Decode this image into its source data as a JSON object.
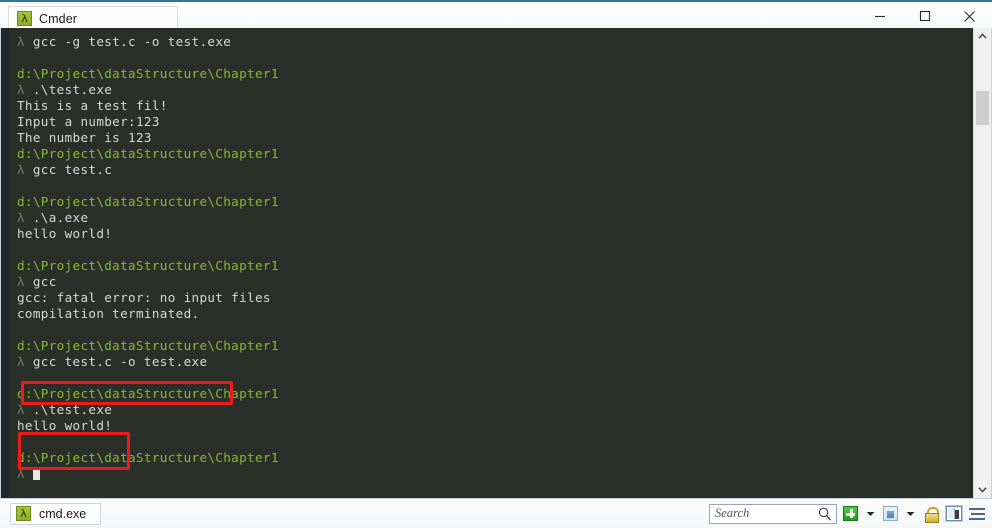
{
  "window": {
    "app_title": "Cmder",
    "tab_icon": "lambda-icon",
    "minimize_label": "Minimize",
    "maximize_label": "Maximize",
    "close_label": "Close"
  },
  "colors": {
    "path_green": "#8ab82e",
    "prompt_gray": "#6f7a63",
    "output_gray": "#d7d9d3",
    "terminal_bg": "#2b2f29",
    "annotation_red": "#ee1b1b",
    "titlebar_accent": "#2e7899"
  },
  "terminal": {
    "prompt_symbol": "λ",
    "cursor": "block-cursor",
    "lines": [
      {
        "type": "command",
        "prompt": "λ ",
        "text": "gcc -g test.c -o test.exe"
      },
      {
        "type": "blank",
        "text": ""
      },
      {
        "type": "path",
        "text": "d:\\Project\\dataStructure\\Chapter1"
      },
      {
        "type": "command",
        "prompt": "λ ",
        "text": ".\\test.exe"
      },
      {
        "type": "output",
        "text": "This is a test fil!"
      },
      {
        "type": "output",
        "text": "Input a number:123"
      },
      {
        "type": "output",
        "text": "The number is 123"
      },
      {
        "type": "path",
        "text": "d:\\Project\\dataStructure\\Chapter1"
      },
      {
        "type": "command",
        "prompt": "λ ",
        "text": "gcc test.c"
      },
      {
        "type": "blank",
        "text": ""
      },
      {
        "type": "path",
        "text": "d:\\Project\\dataStructure\\Chapter1"
      },
      {
        "type": "command",
        "prompt": "λ ",
        "text": ".\\a.exe"
      },
      {
        "type": "output",
        "text": "hello world!"
      },
      {
        "type": "blank",
        "text": ""
      },
      {
        "type": "path",
        "text": "d:\\Project\\dataStructure\\Chapter1"
      },
      {
        "type": "command",
        "prompt": "λ ",
        "text": "gcc"
      },
      {
        "type": "output",
        "text": "gcc: fatal error: no input files"
      },
      {
        "type": "output",
        "text": "compilation terminated."
      },
      {
        "type": "blank",
        "text": ""
      },
      {
        "type": "path",
        "text": "d:\\Project\\dataStructure\\Chapter1"
      },
      {
        "type": "command",
        "prompt": "λ ",
        "text": "gcc test.c -o test.exe"
      },
      {
        "type": "blank",
        "text": ""
      },
      {
        "type": "path",
        "text": "d:\\Project\\dataStructure\\Chapter1"
      },
      {
        "type": "command",
        "prompt": "λ ",
        "text": ".\\test.exe"
      },
      {
        "type": "output",
        "text": "hello world!"
      },
      {
        "type": "blank",
        "text": ""
      },
      {
        "type": "path",
        "text": "d:\\Project\\dataStructure\\Chapter1"
      },
      {
        "type": "cursor",
        "prompt": "λ ",
        "text": ""
      }
    ]
  },
  "annotations": [
    {
      "id": "annot-1",
      "target": "gcc test.c -o test.exe"
    },
    {
      "id": "annot-2",
      "target": ".\\test.exe / hello world!"
    }
  ],
  "scrollbar": {
    "up_arrow": "chevron-up-icon",
    "down_arrow": "chevron-down-icon"
  },
  "statusbar": {
    "shell_tab_label": "cmd.exe",
    "shell_tab_icon": "lambda-icon",
    "search": {
      "placeholder": "Search",
      "value": "",
      "icon": "search-icon"
    },
    "buttons": [
      {
        "name": "new-console-button",
        "icon": "green-plus-icon"
      },
      {
        "name": "new-console-dropdown",
        "icon": "chevron-down-icon"
      },
      {
        "name": "active-console-button",
        "icon": "window-icon"
      },
      {
        "name": "active-console-dropdown",
        "icon": "chevron-down-icon"
      },
      {
        "name": "lock-button",
        "icon": "lock-icon"
      },
      {
        "name": "toggle-panel-button",
        "icon": "panel-icon"
      },
      {
        "name": "menu-button",
        "icon": "hamburger-menu-icon"
      }
    ]
  }
}
